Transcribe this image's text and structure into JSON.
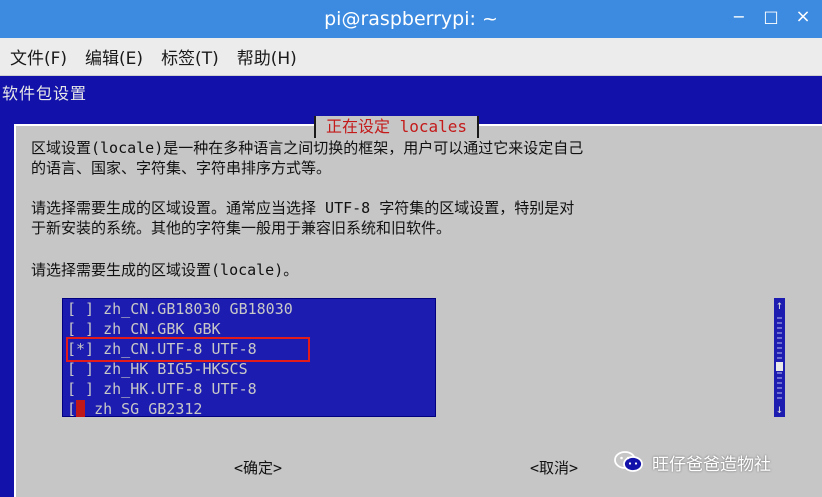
{
  "window": {
    "title": "pi@raspberrypi: ~",
    "controls": {
      "minimize": "−",
      "maximize": "□",
      "close": "×"
    }
  },
  "menubar": {
    "items": [
      "文件(F)",
      "编辑(E)",
      "标签(T)",
      "帮助(H)"
    ]
  },
  "terminal": {
    "backtitle": "软件包设置",
    "dialog": {
      "title": "正在设定 locales",
      "paragraph1": [
        "区域设置(locale)是一种在多种语言之间切换的框架，用户可以通过它来设定自己",
        "的语言、国家、字符集、字符串排序方式等。"
      ],
      "paragraph2": [
        "请选择需要生成的区域设置。通常应当选择 UTF-8 字符集的区域设置，特别是对",
        "于新安装的系统。其他的字符集一般用于兼容旧系统和旧软件。"
      ],
      "prompt": "请选择需要生成的区域设置(locale)。",
      "locales": [
        {
          "mark": "[ ]",
          "text": "zh_CN.GB18030 GB18030"
        },
        {
          "mark": "[ ]",
          "text": "zh_CN.GBK GBK"
        },
        {
          "mark": "[*]",
          "text": "zh_CN.UTF-8 UTF-8"
        },
        {
          "mark": "[ ]",
          "text": "zh_HK BIG5-HKSCS"
        },
        {
          "mark": "[ ]",
          "text": "zh_HK.UTF-8 UTF-8"
        },
        {
          "mark": "[",
          "text": "zh_SG GB2312"
        }
      ],
      "scrollbar": {
        "up": "↑",
        "down": "↓"
      },
      "ok_button": "<确定>",
      "cancel_button": "<取消>"
    }
  },
  "watermark": {
    "text": "旺仔爸爸造物社",
    "icon": "wechat-icon"
  },
  "colors": {
    "titlebar": "#3d8be0",
    "terminal_bg": "#1212aa",
    "dialog_bg": "#c6c6c6",
    "highlight": "#e21b1b"
  }
}
